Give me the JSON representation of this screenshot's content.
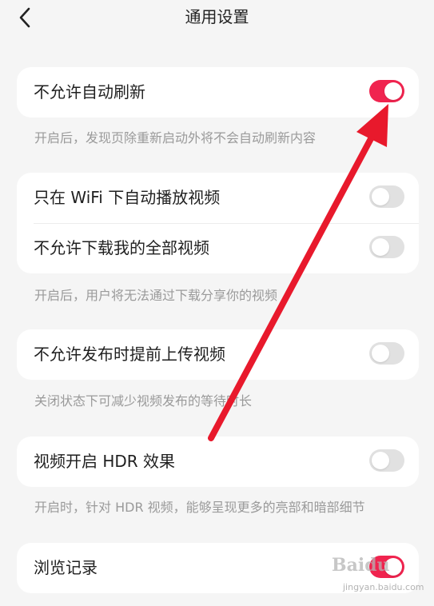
{
  "header": {
    "title": "通用设置"
  },
  "sections": [
    {
      "rows": [
        {
          "label": "不允许自动刷新",
          "on": true
        }
      ],
      "description": "开启后，发现页除重新启动外将不会自动刷新内容"
    },
    {
      "rows": [
        {
          "label": "只在 WiFi 下自动播放视频",
          "on": false
        },
        {
          "label": "不允许下载我的全部视频",
          "on": false
        }
      ],
      "description": "开启后，用户将无法通过下载分享你的视频"
    },
    {
      "rows": [
        {
          "label": "不允许发布时提前上传视频",
          "on": false
        }
      ],
      "description": "关闭状态下可减少视频发布的等待时长"
    },
    {
      "rows": [
        {
          "label": "视频开启 HDR 效果",
          "on": false
        }
      ],
      "description": "开启时，针对 HDR 视频，能够呈现更多的亮部和暗部细节"
    },
    {
      "rows": [
        {
          "label": "浏览记录",
          "on": true
        }
      ]
    }
  ],
  "watermark": {
    "brand": "Baidu",
    "site": "jingyan.baidu.com"
  },
  "colors": {
    "toggle_on": "#f0244f",
    "toggle_off": "#e1e1e1",
    "background": "#f5f5f5",
    "arrow": "#e8192c"
  }
}
